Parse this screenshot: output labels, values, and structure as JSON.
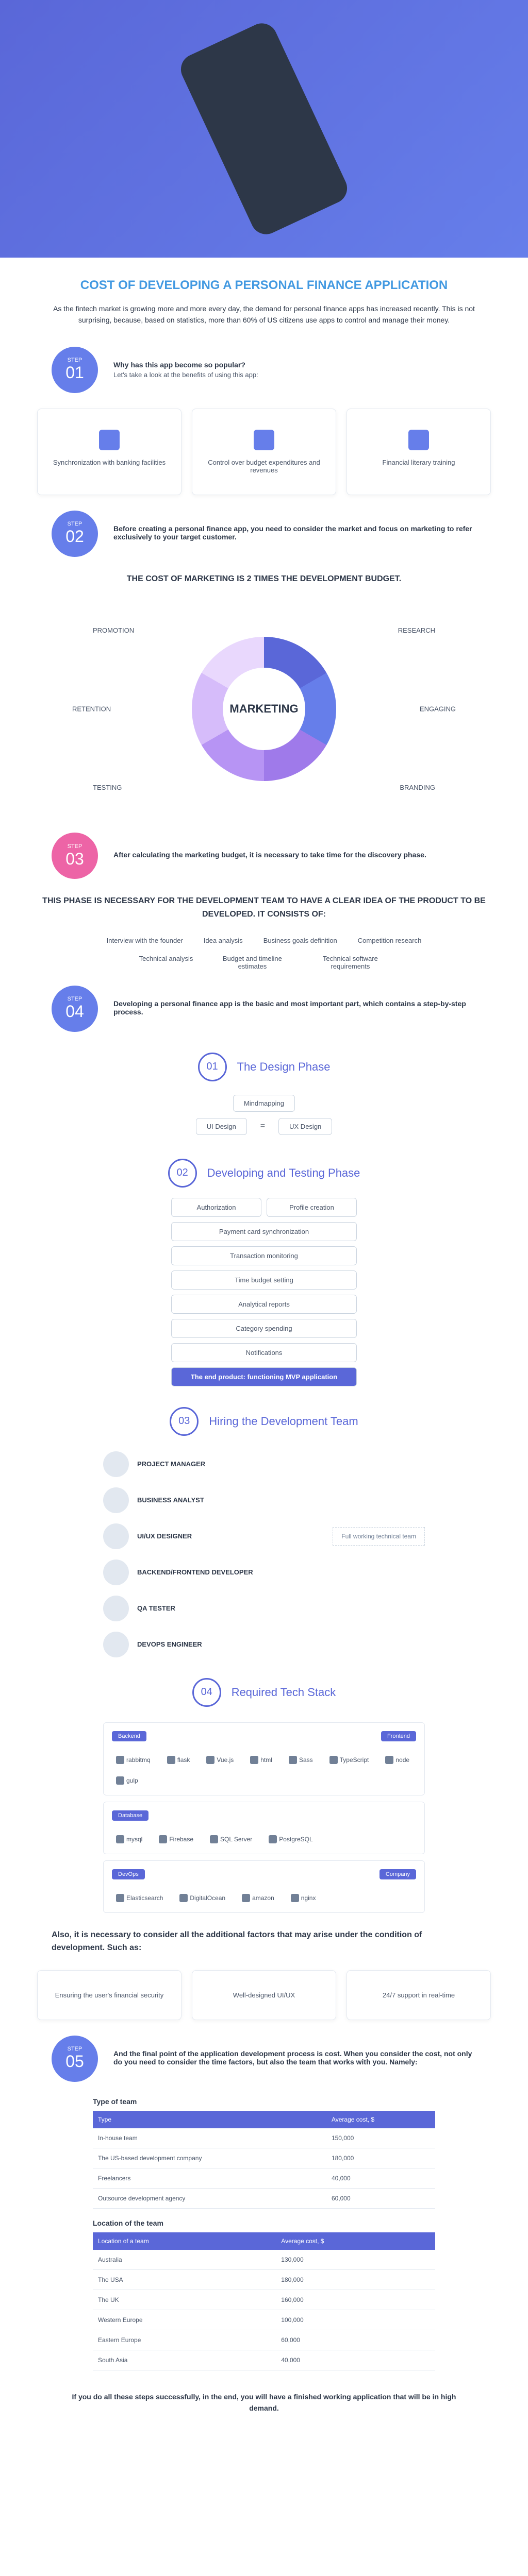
{
  "title": "COST OF DEVELOPING A PERSONAL FINANCE APPLICATION",
  "intro": "As the fintech market is growing more and more every day, the demand for personal finance apps has increased recently. This is not surprising, because, based on statistics, more than 60% of US citizens use apps to control and manage their money.",
  "step1": {
    "label": "STEP",
    "num": "01",
    "title": "Why has this app become so popular?",
    "desc": "Let's take a look at the benefits of using this app:"
  },
  "benefits": [
    "Synchronization with banking facilities",
    "Control over budget expenditures and revenues",
    "Financial literary training"
  ],
  "step2": {
    "label": "STEP",
    "num": "02",
    "desc": "Before creating a personal finance app, you need to consider the market and focus on marketing to refer exclusively to your target customer."
  },
  "marketing_headline": "THE COST OF MARKETING IS 2 TIMES THE DEVELOPMENT BUDGET.",
  "donut_center": "MARKETING",
  "marketing_labels": {
    "promotion": "PROMOTION",
    "research": "RESEARCH",
    "retention": "RETENTION",
    "engaging": "ENGAGING",
    "testing": "TESTING",
    "branding": "BRANDING"
  },
  "step3": {
    "label": "STEP",
    "num": "03",
    "desc": "After calculating the marketing budget, it is necessary to take time for the discovery phase."
  },
  "discovery_headline": "THIS PHASE IS NECESSARY FOR THE DEVELOPMENT TEAM TO HAVE A CLEAR IDEA OF THE PRODUCT TO BE DEVELOPED. IT CONSISTS OF:",
  "discovery_row1": [
    "Interview with the founder",
    "Idea analysis",
    "Business goals definition",
    "Competition research"
  ],
  "discovery_row2": [
    "Technical analysis",
    "Budget and timeline estimates",
    "Technical software requirements"
  ],
  "step4": {
    "label": "STEP",
    "num": "04",
    "desc": "Developing a personal finance app is the basic and most important part, which contains a step-by-step process."
  },
  "phase01": {
    "num": "01",
    "title": "The Design Phase"
  },
  "design_root": "Mindmapping",
  "design_left": "UI Design",
  "design_right": "UX Design",
  "phase02": {
    "num": "02",
    "title": "Developing and Testing Phase"
  },
  "features_pairs": [
    [
      "Authorization",
      "Profile creation"
    ]
  ],
  "features": [
    "Payment card synchronization",
    "Transaction monitoring",
    "Time budget setting",
    "Analytical reports",
    "Category spending",
    "Notifications"
  ],
  "features_end": "The end product: functioning MVP application",
  "phase03": {
    "num": "03",
    "title": "Hiring the Development Team"
  },
  "team": [
    "PROJECT MANAGER",
    "BUSINESS ANALYST",
    "UI/UX DESIGNER",
    "BACKEND/FRONTEND DEVELOPER",
    "QA TESTER",
    "DEVOPS ENGINEER"
  ],
  "team_note": "Full working technical team",
  "phase04": {
    "num": "04",
    "title": "Required Tech Stack"
  },
  "tech": {
    "backend": {
      "label": "Backend",
      "items": [
        "rabbitmq",
        "flask"
      ]
    },
    "frontend": {
      "label": "Frontend",
      "items": [
        "Vue.js",
        "html",
        "Sass",
        "TypeScript",
        "node",
        "gulp"
      ]
    },
    "db": {
      "label": "Database",
      "items": [
        "mysql",
        "Firebase",
        "SQL Server",
        "PostgreSQL"
      ]
    },
    "devops": {
      "label": "DevOps",
      "items": [
        "Elasticsearch",
        "DigitalOcean",
        "amazon",
        "nginx"
      ]
    }
  },
  "factors_headline": "Also, it is necessary to consider all the additional factors that may arise under the condition of development. Such as:",
  "factors": [
    "Ensuring the user's financial security",
    "Well-designed UI/UX",
    "24/7 support in real-time"
  ],
  "step5": {
    "label": "STEP",
    "num": "05",
    "desc": "And the final point of the application development process is cost. When you consider the cost, not only do you need to consider the time factors, but also the team that works with you. Namely:"
  },
  "table1_title": "Type of team",
  "table1": {
    "headers": [
      "Type",
      "Average cost, $"
    ],
    "rows": [
      [
        "In-house team",
        "150,000"
      ],
      [
        "The US-based development company",
        "180,000"
      ],
      [
        "Freelancers",
        "40,000"
      ],
      [
        "Outsource development agency",
        "60,000"
      ]
    ]
  },
  "table2_title": "Location of the team",
  "table2": {
    "headers": [
      "Location of a team",
      "Average cost, $"
    ],
    "rows": [
      [
        "Australia",
        "130,000"
      ],
      [
        "The USA",
        "180,000"
      ],
      [
        "The UK",
        "160,000"
      ],
      [
        "Western Europe",
        "100,000"
      ],
      [
        "Eastern Europe",
        "60,000"
      ],
      [
        "South Asia",
        "40,000"
      ]
    ]
  },
  "closing": "If you do all these steps successfully, in the end, you will have a finished working application that will be in high demand."
}
